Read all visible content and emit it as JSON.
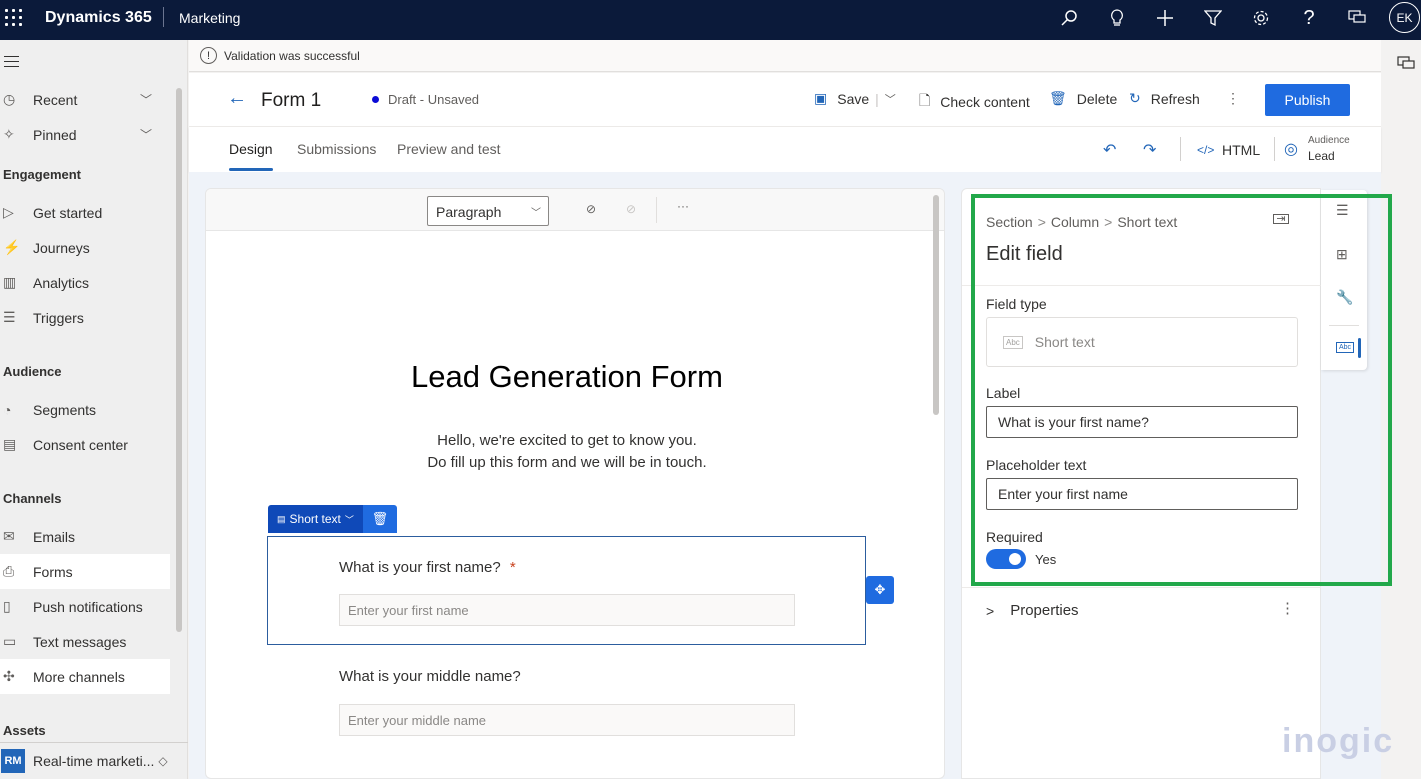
{
  "topbar": {
    "brand": "Dynamics 365",
    "app": "Marketing",
    "icons": [
      "search-icon",
      "lightbulb-icon",
      "add-icon",
      "filter-icon",
      "settings-icon",
      "help-icon",
      "chat-icon"
    ],
    "avatar_initials": "EK"
  },
  "validation": {
    "message": "Validation was successful"
  },
  "sidebar": {
    "items_top": [
      {
        "label": "Recent",
        "icon": "clock-icon",
        "expandable": true
      },
      {
        "label": "Pinned",
        "icon": "pin-icon",
        "expandable": true
      }
    ],
    "groups": [
      {
        "title": "Engagement",
        "items": [
          {
            "label": "Get started",
            "icon": "play-icon"
          },
          {
            "label": "Journeys",
            "icon": "journeys-icon"
          },
          {
            "label": "Analytics",
            "icon": "analytics-icon"
          },
          {
            "label": "Triggers",
            "icon": "triggers-icon"
          }
        ]
      },
      {
        "title": "Audience",
        "items": [
          {
            "label": "Segments",
            "icon": "segments-icon"
          },
          {
            "label": "Consent center",
            "icon": "consent-icon"
          }
        ]
      },
      {
        "title": "Channels",
        "items": [
          {
            "label": "Emails",
            "icon": "mail-icon"
          },
          {
            "label": "Forms",
            "icon": "form-icon",
            "active": true
          },
          {
            "label": "Push notifications",
            "icon": "push-icon"
          },
          {
            "label": "Text messages",
            "icon": "sms-icon"
          },
          {
            "label": "More channels",
            "icon": "puzzle-icon",
            "highlight": true
          }
        ]
      },
      {
        "title": "Assets",
        "items": []
      }
    ],
    "area": {
      "badge": "RM",
      "label": "Real-time marketi..."
    }
  },
  "header": {
    "title": "Form 1",
    "status": "Draft - Unsaved",
    "commands": {
      "save": "Save",
      "check": "Check content",
      "delete": "Delete",
      "refresh": "Refresh",
      "publish": "Publish"
    }
  },
  "tabs": {
    "items": [
      "Design",
      "Submissions",
      "Preview and test"
    ],
    "active": "Design",
    "html": "HTML",
    "audience_label": "Audience",
    "audience_value": "Lead"
  },
  "canvas": {
    "paragraph": "Paragraph",
    "title": "Lead Generation Form",
    "desc1": "Hello, we're excited to get to know you.",
    "desc2": "Do fill up this form and we will be in touch.",
    "chip_label": "Short text",
    "fields": [
      {
        "label": "What is your first name?",
        "required_mark": "*",
        "placeholder": "Enter your first name"
      },
      {
        "label": "What is your middle name?",
        "placeholder": "Enter your middle name"
      }
    ]
  },
  "panel": {
    "breadcrumb": [
      "Section",
      "Column",
      "Short text"
    ],
    "title": "Edit field",
    "field_type_label": "Field type",
    "field_type_abc": "Abc",
    "field_type_value": "Short text",
    "label_label": "Label",
    "label_value": "What is your first name?",
    "placeholder_label": "Placeholder text",
    "placeholder_value": "Enter your first name",
    "required_label": "Required",
    "required_on": true,
    "required_text": "Yes",
    "properties": "Properties",
    "rail_abc": "Abc"
  },
  "watermark": "inogic"
}
